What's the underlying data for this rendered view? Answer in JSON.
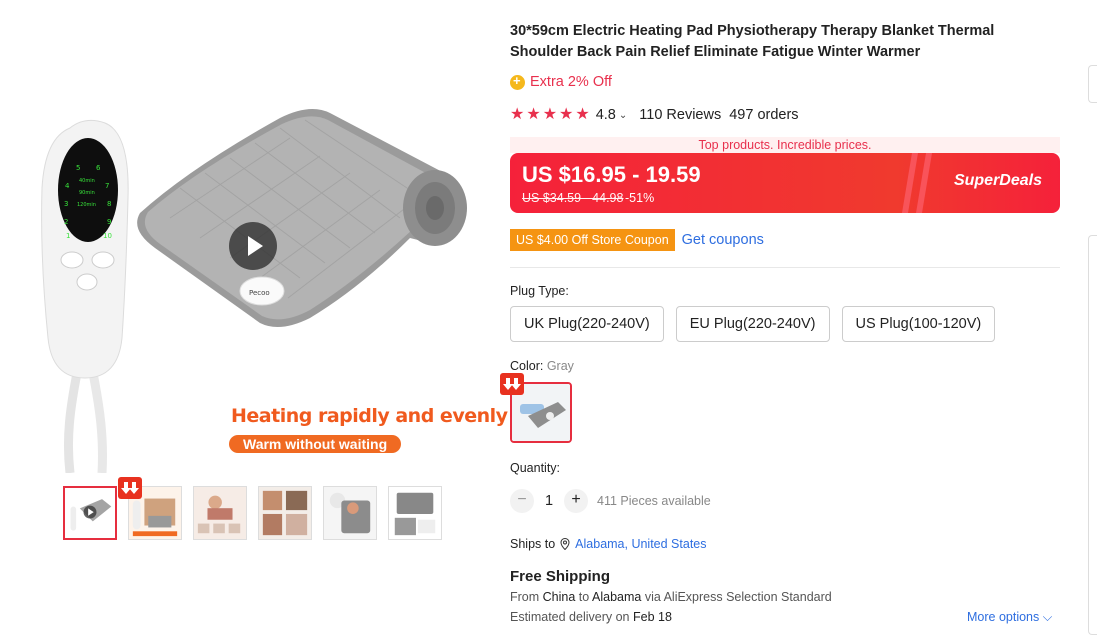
{
  "gallery": {
    "promo_headline": "Heating rapidly and evenly",
    "promo_sub": "Warm without waiting",
    "remote_numbers": [
      "5",
      "6",
      "4",
      "7",
      "3",
      "8",
      "2",
      "9",
      "1",
      "10"
    ],
    "remote_times": [
      "40min",
      "90min",
      "120min"
    ],
    "pad_brand": "Pecoo",
    "thumbnails": [
      {
        "name": "thumb-video",
        "active": true
      },
      {
        "name": "thumb-2",
        "active": false
      },
      {
        "name": "thumb-3",
        "active": false
      },
      {
        "name": "thumb-4",
        "active": false
      },
      {
        "name": "thumb-5",
        "active": false
      },
      {
        "name": "thumb-6",
        "active": false
      }
    ]
  },
  "product": {
    "title": "30*59cm Electric Heating Pad Physiotherapy Therapy Blanket Thermal Shoulder Back Pain Relief Eliminate Fatigue Winter Warmer",
    "extra_offer": "Extra 2% Off",
    "rating": "4.8",
    "reviews": "110 Reviews",
    "orders": "497 orders"
  },
  "price": {
    "strip": "Top products. Incredible prices.",
    "current": "US $16.95 - 19.59",
    "original": "US $34.59 - 44.98",
    "discount": "-51%",
    "badge": "SuperDeals"
  },
  "coupon": {
    "label": "US $4.00 Off Store Coupon",
    "link": "Get coupons"
  },
  "options": {
    "plug_label": "Plug Type:",
    "plugs": [
      "UK Plug(220-240V)",
      "EU Plug(220-240V)",
      "US Plug(100-120V)"
    ],
    "color_label": "Color:",
    "color_value": "Gray"
  },
  "quantity": {
    "label": "Quantity:",
    "minus": "−",
    "value": "1",
    "plus": "+",
    "available": "411 Pieces available"
  },
  "shipping": {
    "ships_to_label": "Ships to",
    "location": "Alabama, United States",
    "free": "Free Shipping",
    "from_prefix": "From ",
    "origin": "China",
    "to_word": " to ",
    "dest": "Alabama",
    "via": " via AliExpress Selection Standard",
    "est_prefix": "Estimated delivery on ",
    "est_date": "Feb 18",
    "more_options": "More options"
  },
  "colors": {
    "accent": "#e8304d",
    "price_red": "#f5213a",
    "coupon_orange": "#f59412",
    "link_blue": "#2e6ee0"
  }
}
